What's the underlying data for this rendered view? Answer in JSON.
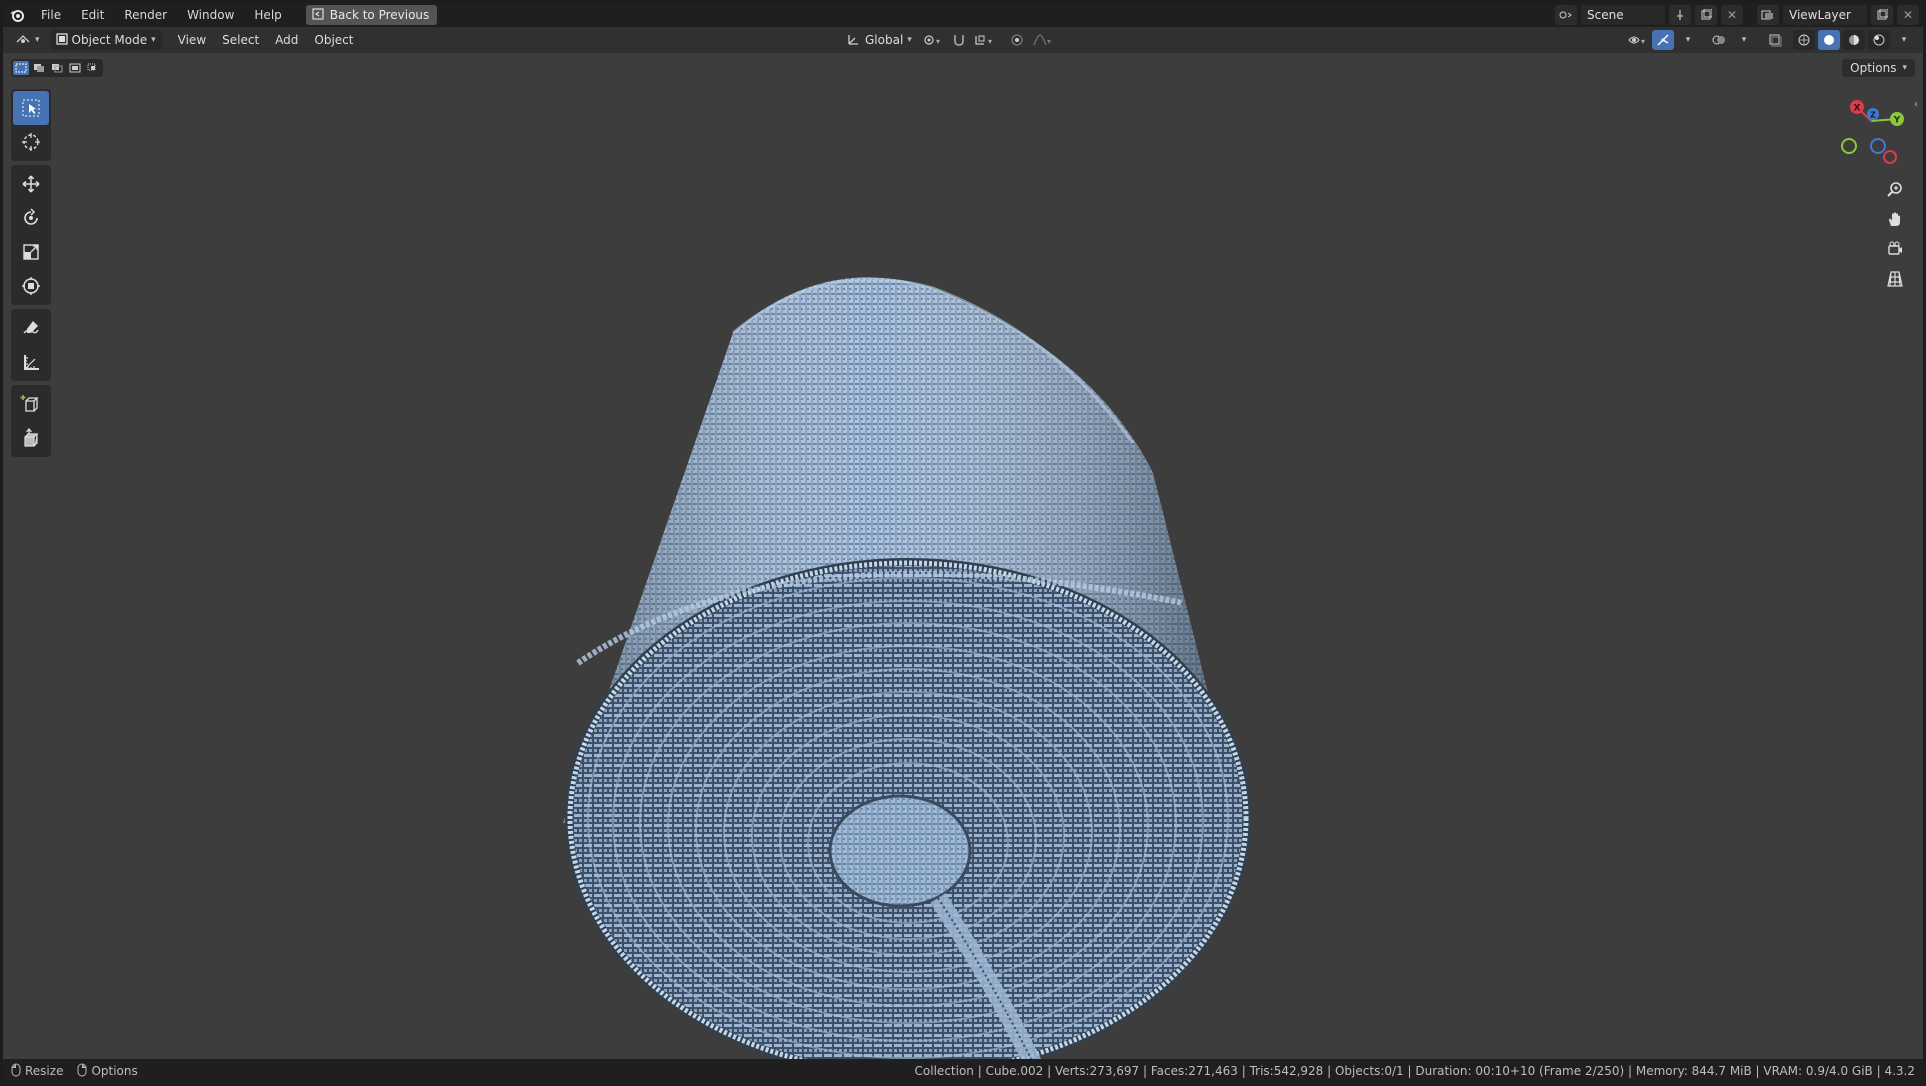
{
  "menubar": {
    "items": [
      "File",
      "Edit",
      "Render",
      "Window",
      "Help"
    ],
    "back_button": "Back to Previous",
    "scene_name": "Scene",
    "view_layer": "ViewLayer"
  },
  "header": {
    "mode": "Object Mode",
    "menus": [
      "View",
      "Select",
      "Add",
      "Object"
    ],
    "orientation": "Global",
    "options_label": "Options"
  },
  "toolbar": {
    "tools": [
      "select-box",
      "cursor",
      "move",
      "rotate",
      "scale",
      "transform",
      "annotate",
      "measure",
      "add-cube",
      "extrude"
    ],
    "active_tool": "select-box"
  },
  "gizmo": {
    "x": "X",
    "y": "Y",
    "z": "Z"
  },
  "statusbar": {
    "left": [
      "Resize",
      "Options"
    ],
    "info": "Collection | Cube.002 | Verts:273,697 | Faces:271,463 | Tris:542,928 | Objects:0/1 | Duration: 00:10+10 (Frame 2/250) | Memory: 844.7 MiB | VRAM: 0.9/4.0 GiB | 4.3.2"
  },
  "colors": {
    "accent": "#4772b3",
    "viewport_bg": "#3d3d3d",
    "mesh": "#8fa9c8",
    "axis_x": "#e0394b",
    "axis_y": "#8bc83c",
    "axis_z": "#3f7ad8"
  }
}
